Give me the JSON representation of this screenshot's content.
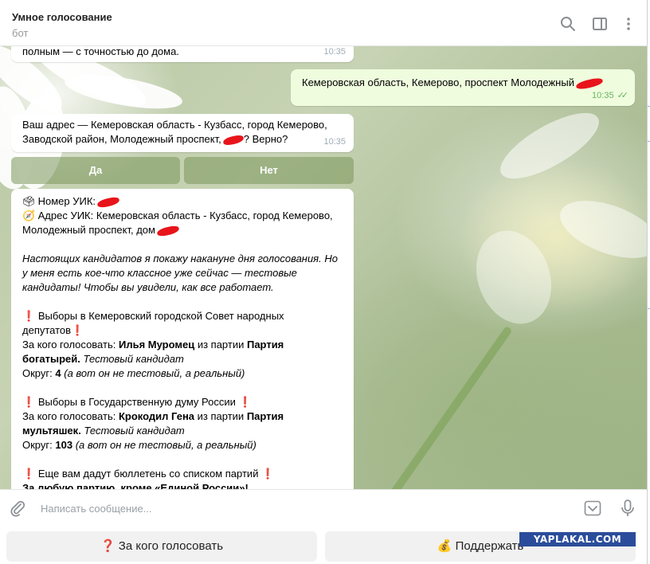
{
  "header": {
    "title": "Умное голосование",
    "subtitle": "бот"
  },
  "messages": {
    "m1": {
      "text": "полным — с точностью до дома.",
      "time": "10:35"
    },
    "m2": {
      "text": "Кемеровская область, Кемерово, проспект Молодежный",
      "time": "10:35"
    },
    "m3": {
      "line1": "Ваш адрес — Кемеровская область - Кузбасс, город Кемерово,",
      "line2a": "Заводской район, Молодежный проспект,",
      "line2b": "? Верно?",
      "time": "10:35"
    },
    "buttons": {
      "yes": "Да",
      "no": "Нет"
    },
    "m4": {
      "uik_number": "Номер УИК:",
      "uik_address_1": "Адрес УИК: Кемеровская область - Кузбасс, город Кемерово,",
      "uik_address_2": "Молодежный проспект, дом",
      "intro_1": "Настоящих кандидатов я покажу накануне дня голосования. Но",
      "intro_2": "у меня есть кое-что классное уже сейчас — тестовые",
      "intro_3": "кандидаты! Чтобы вы увидели, как все работает.",
      "e1_title_1": "Выборы в Кемеровский городской Совет народных",
      "e1_title_2": "депутатов",
      "vote_for": "За кого голосовать:",
      "e1_candidate": "Илья Муромец",
      "from_party": "из партии",
      "e1_party_1": "Партия",
      "e1_party_2": "богатырей.",
      "test_candidate": "Тестовый кандидат",
      "district": "Округ:",
      "e1_district": "4",
      "district_note": "(а вот он не тестовый, а реальный)",
      "e2_title": "Выборы в Государственную думу России",
      "e2_candidate": "Крокодил Гена",
      "e2_party_1": "Партия",
      "e2_party_2": "мультяшек.",
      "e2_district": "103",
      "e3_title": "Еще вам дадут бюллетень со списком партий",
      "e3_line": "За любую партию, кроме «Единой России»!"
    }
  },
  "composer": {
    "placeholder": "Написать сообщение..."
  },
  "keyboard": {
    "left": "❓ За кого голосовать",
    "right": "💰 Поддержать"
  },
  "watermark": "YAPLAKAL.COM",
  "icons": {
    "search": "search-icon",
    "sidebar": "sidebar-toggle-icon",
    "more": "more-vertical-icon",
    "attach": "paperclip-icon",
    "keyboard": "bot-keyboard-icon",
    "mic": "microphone-icon"
  }
}
